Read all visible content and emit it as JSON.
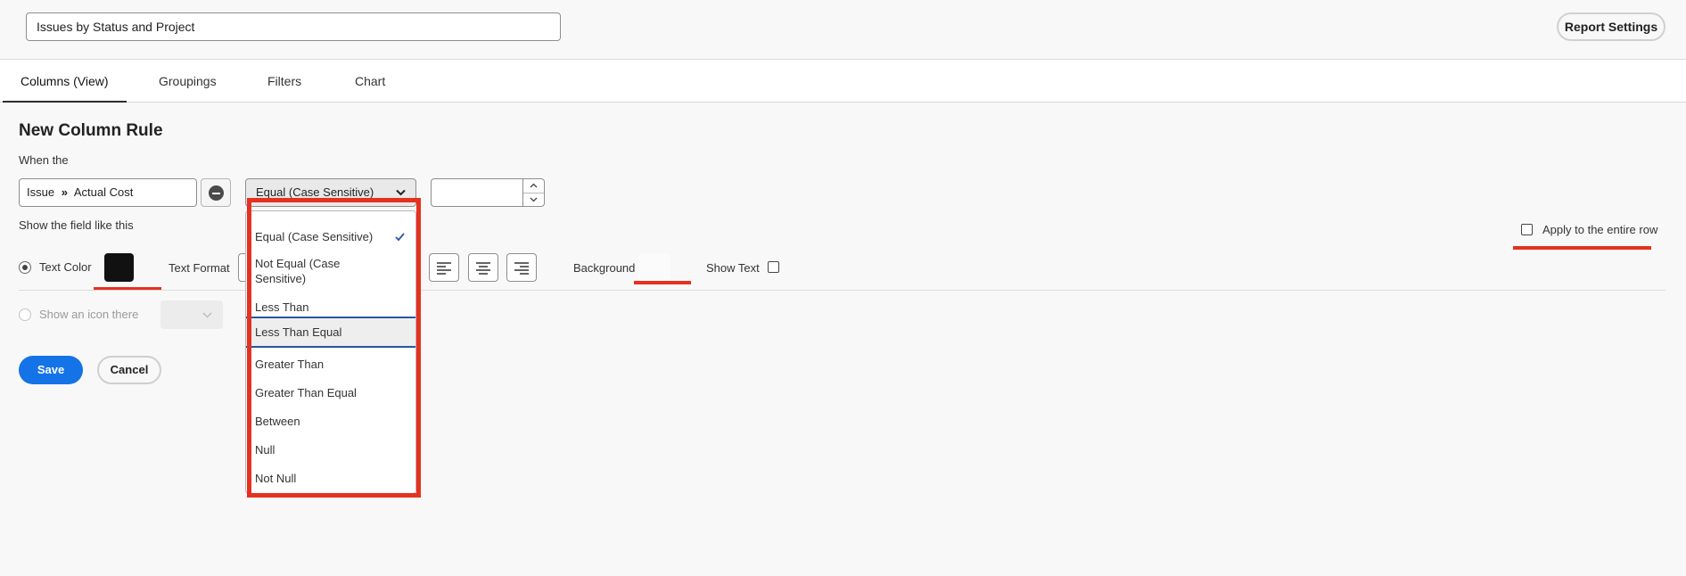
{
  "header": {
    "report_title": "Issues by Status and Project",
    "report_settings": "Report Settings"
  },
  "tabs": [
    "Columns (View)",
    "Groupings",
    "Filters",
    "Chart"
  ],
  "rule": {
    "heading": "New Column Rule",
    "when_label": "When the",
    "field_object": "Issue",
    "field_name": "Actual Cost",
    "operator_selected": "Equal (Case Sensitive)",
    "value": "",
    "show_label": "Show the field like this",
    "apply_entire_row": "Apply to the entire row",
    "text_color_label": "Text Color",
    "text_color": "#111111",
    "text_format_label": "Text Format",
    "background_label": "Background",
    "show_text_label": "Show Text",
    "show_icon_label": "Show an icon there"
  },
  "actions": {
    "save": "Save",
    "cancel": "Cancel"
  },
  "operator_options": [
    "Equal (Case Sensitive)",
    "Not Equal (Case Sensitive)",
    "Less Than",
    "Less Than Equal",
    "Greater Than",
    "Greater Than Equal",
    "Between",
    "Null",
    "Not Null"
  ],
  "colors": {
    "accent": "#1473e6",
    "highlight_annotation": "#e5311f",
    "focus_border": "#2a55a4"
  }
}
